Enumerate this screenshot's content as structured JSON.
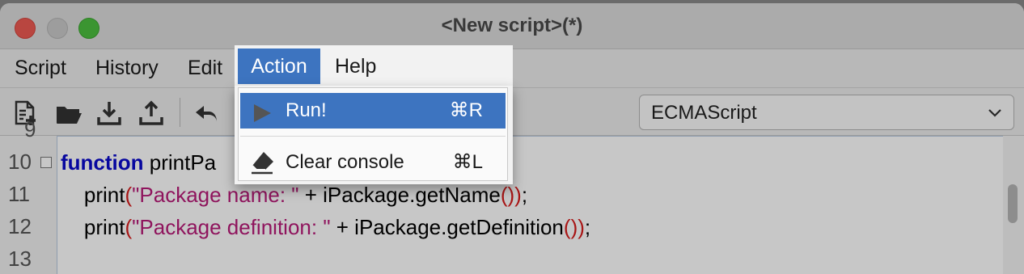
{
  "window": {
    "title": "<New script>(*)"
  },
  "menubar": {
    "items": [
      "Script",
      "History",
      "Edit",
      "Action",
      "Help"
    ],
    "open_menu": "Action"
  },
  "toolbar": {
    "icons": [
      "new-script-icon",
      "open-folder-icon",
      "download-icon",
      "upload-icon",
      "undo-icon"
    ],
    "language": "ECMAScript"
  },
  "action_menu": {
    "items": [
      {
        "label": "Run!",
        "shortcut": "⌘R",
        "icon": "play-icon",
        "highlighted": true
      },
      {
        "label": "Clear console",
        "shortcut": "⌘L",
        "icon": "eraser-icon",
        "highlighted": false
      }
    ]
  },
  "editor": {
    "lines": [
      {
        "number": "9",
        "text": ""
      },
      {
        "number": "10",
        "keyword": "function",
        "rest": " printPa"
      },
      {
        "number": "11",
        "indent": "    ",
        "fn": "print",
        "open": "(",
        "string": "\"Package name: \"",
        "mid": " + iPackage.getName",
        "close": "())",
        "end": ";"
      },
      {
        "number": "12",
        "indent": "    ",
        "fn": "print",
        "open": "(",
        "string": "\"Package definition: \"",
        "mid": " + iPackage.getDefinition",
        "close": "())",
        "end": ";"
      },
      {
        "number": "13",
        "text": ""
      }
    ]
  },
  "colors": {
    "keyword": "#0a0acc",
    "string": "#b81a78",
    "paren": "#d81b1b",
    "menu_highlight": "#3d74c0"
  }
}
